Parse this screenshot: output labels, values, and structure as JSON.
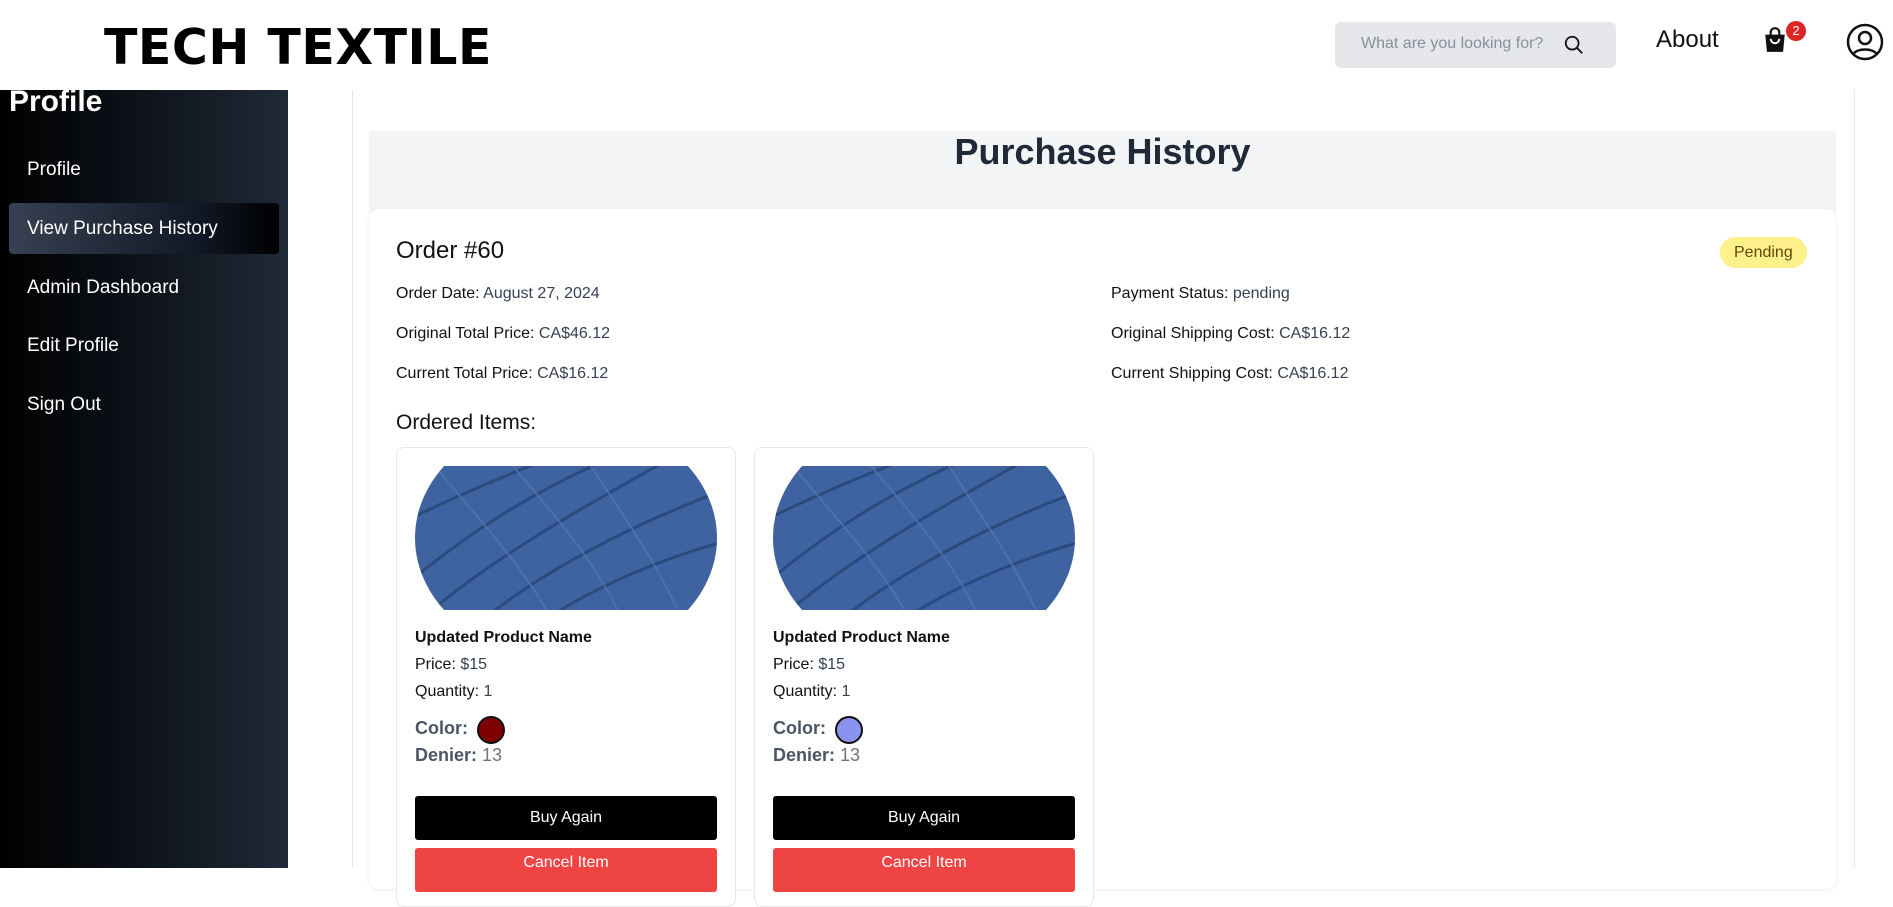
{
  "header": {
    "brand": "TECH TEXTILE",
    "search_placeholder": "What are you looking for?",
    "about": "About",
    "cart_count": "2",
    "icons": {
      "search": "search-icon",
      "cart": "shopping-bag-icon",
      "account": "user-circle-icon"
    }
  },
  "sidebar": {
    "title": "Profile",
    "items": [
      {
        "label": "Profile",
        "active": false
      },
      {
        "label": "View Purchase History",
        "active": true
      },
      {
        "label": "Admin Dashboard",
        "active": false
      },
      {
        "label": "Edit Profile",
        "active": false
      },
      {
        "label": "Sign Out",
        "active": false
      }
    ]
  },
  "main": {
    "title": "Purchase History",
    "order": {
      "title": "Order #60",
      "status": "Pending",
      "status_color": "#fef08a",
      "fields": {
        "order_date": {
          "label": "Order Date:",
          "value": "August 27, 2024"
        },
        "original_total": {
          "label": "Original Total Price:",
          "value": "CA$46.12"
        },
        "current_total": {
          "label": "Current Total Price:",
          "value": "CA$16.12"
        },
        "payment_status": {
          "label": "Payment Status:",
          "value": "pending"
        },
        "original_shipping": {
          "label": "Original Shipping Cost:",
          "value": "CA$16.12"
        },
        "current_shipping": {
          "label": "Current Shipping Cost:",
          "value": "CA$16.12"
        }
      },
      "items_heading": "Ordered Items:",
      "items": [
        {
          "name": "Updated Product Name",
          "price_label": "Price:",
          "price": "$15",
          "quantity_label": "Quantity:",
          "quantity": "1",
          "color_label": "Color:",
          "color_hex": "#7f0000",
          "denier_label": "Denier:",
          "denier": "13",
          "buy_again": "Buy Again",
          "cancel": "Cancel Item"
        },
        {
          "name": "Updated Product Name",
          "price_label": "Price:",
          "price": "$15",
          "quantity_label": "Quantity:",
          "quantity": "1",
          "color_label": "Color:",
          "color_hex": "#8b93f0",
          "denier_label": "Denier:",
          "denier": "13",
          "buy_again": "Buy Again",
          "cancel": "Cancel Item"
        }
      ]
    }
  }
}
